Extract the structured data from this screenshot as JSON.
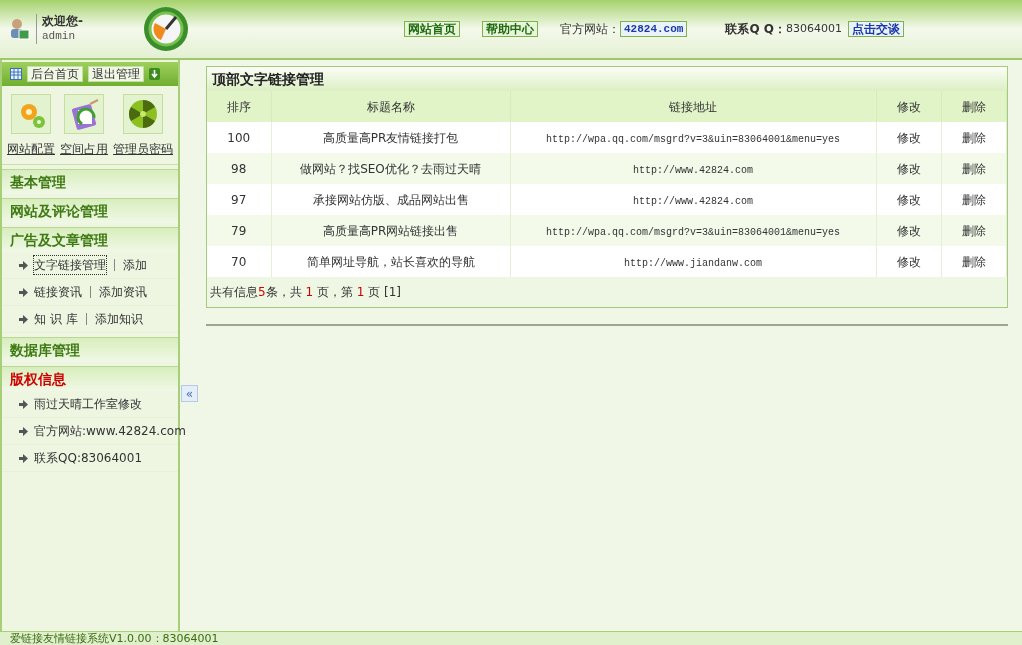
{
  "header": {
    "greeting": "欢迎您-",
    "user": "admin",
    "nav_buttons": [
      "网站首页",
      "帮助中心"
    ],
    "site_label": "官方网站：",
    "site_value": "42824.com",
    "qq_label": "联系Q Q：",
    "qq_value": "83064001",
    "qq_button": "点击交谈"
  },
  "sidebar": {
    "toolbar_buttons": [
      "后台首页",
      "退出管理"
    ],
    "shortcuts": [
      {
        "label": "网站配置",
        "kind": "gear"
      },
      {
        "label": "空间占用",
        "kind": "clipboard"
      },
      {
        "label": "管理员密码",
        "kind": "ball"
      }
    ],
    "sections": [
      {
        "title": "基本管理",
        "kind": "normal"
      },
      {
        "title": "网站及评论管理",
        "kind": "normal"
      },
      {
        "title": "广告及文章管理",
        "kind": "normal",
        "items": [
          {
            "label": "文字链接管理",
            "action": "添加",
            "selected": true
          },
          {
            "label": "链接资讯",
            "action": "添加资讯",
            "selected": false
          },
          {
            "label": "知 识 库",
            "action": "添加知识",
            "selected": false
          }
        ]
      },
      {
        "title": "数据库管理",
        "kind": "normal"
      },
      {
        "title": "版权信息",
        "kind": "highlight",
        "items": [
          {
            "label": "雨过天晴工作室修改",
            "selected": false
          },
          {
            "label": "官方网站:www.42824.com",
            "selected": false
          },
          {
            "label": "联系QQ:83064001",
            "selected": false
          }
        ]
      }
    ]
  },
  "main": {
    "title": "顶部文字链接管理",
    "columns": [
      "排序",
      "标题名称",
      "链接地址",
      "修改",
      "删除"
    ],
    "rows": [
      {
        "order": "100",
        "title": "高质量高PR友情链接打包",
        "url": "http://wpa.qq.com/msgrd?v=3&uin=83064001&menu=yes",
        "edit": "修改",
        "delete": "删除"
      },
      {
        "order": "98",
        "title": "做网站？找SEO优化？去雨过天晴",
        "url": "http://www.42824.com",
        "edit": "修改",
        "delete": "删除"
      },
      {
        "order": "97",
        "title": "承接网站仿版、成品网站出售",
        "url": "http://www.42824.com",
        "edit": "修改",
        "delete": "删除"
      },
      {
        "order": "79",
        "title": "高质量高PR网站链接出售",
        "url": "http://wpa.qq.com/msgrd?v=3&uin=83064001&menu=yes",
        "edit": "修改",
        "delete": "删除"
      },
      {
        "order": "70",
        "title": "简单网址导航，站长喜欢的导航",
        "url": "http://www.jiandanw.com",
        "edit": "修改",
        "delete": "删除"
      }
    ],
    "pager": [
      {
        "text": "共有信息",
        "kind": "text"
      },
      {
        "text": "5",
        "kind": "number"
      },
      {
        "text": "条，共 ",
        "kind": "text"
      },
      {
        "text": "1",
        "kind": "number"
      },
      {
        "text": " 页，第 ",
        "kind": "text"
      },
      {
        "text": "1",
        "kind": "number"
      },
      {
        "text": " 页 [1]",
        "kind": "text"
      }
    ]
  },
  "collapse_button": "«",
  "status_bar": "爱链接友情链接系统V1.0.00：83064001"
}
